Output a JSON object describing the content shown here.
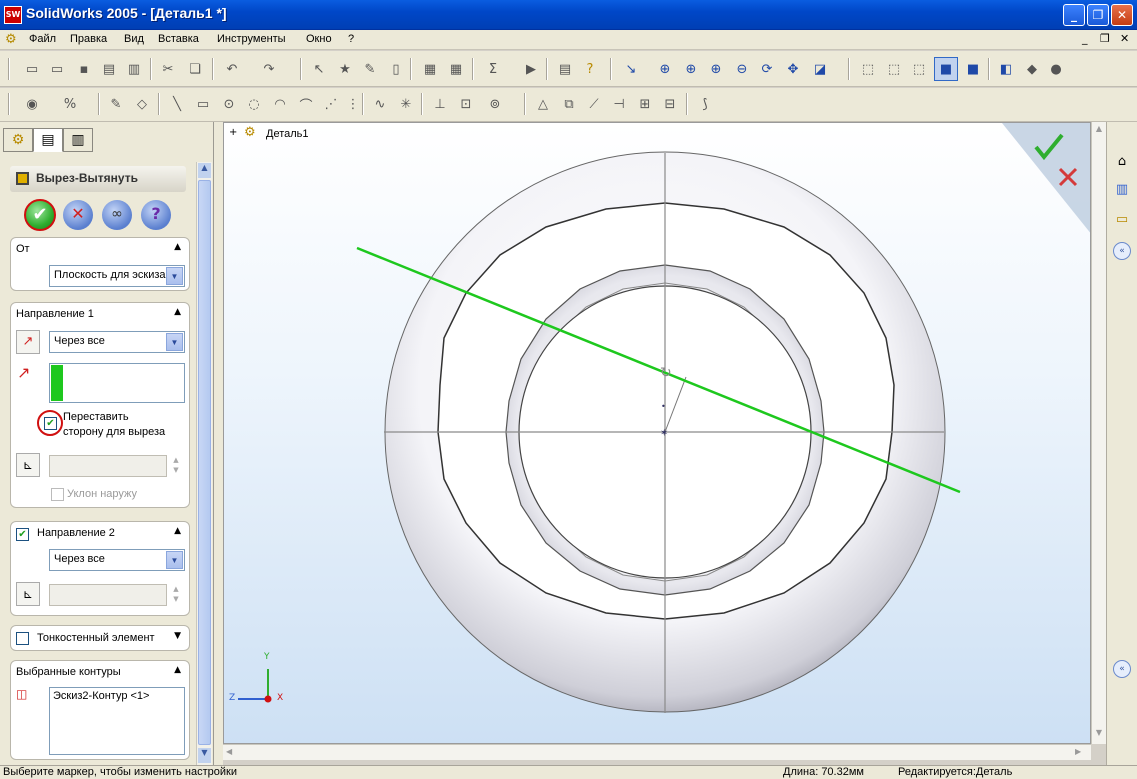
{
  "window": {
    "title": "SolidWorks 2005 - [Деталь1 *]",
    "app_icon_text": "SW"
  },
  "menu": [
    "Файл",
    "Правка",
    "Вид",
    "Вставка",
    "Инструменты",
    "Окно",
    "?"
  ],
  "feature_manager": {
    "feature_title": "Вырез-Вытянуть",
    "from_section": {
      "label": "От",
      "selected": "Плоскость для эскиза"
    },
    "direction1": {
      "label": "Направление 1",
      "end_condition": "Через все",
      "flip_side_label_line1": "Переставить",
      "flip_side_label_line2": "сторону для выреза",
      "flip_side_checked": true,
      "draft_outward_label": "Уклон наружу"
    },
    "direction2": {
      "label": "Направление 2",
      "enabled": true,
      "end_condition": "Через все"
    },
    "thin_feature": {
      "label": "Тонкостенный элемент"
    },
    "selected_contours": {
      "label": "Выбранные контуры",
      "items": [
        "Эскиз2-Контур <1>"
      ]
    }
  },
  "tree": {
    "root": "Деталь1"
  },
  "triad": {
    "x": "X",
    "y": "Y",
    "z": "Z"
  },
  "status": {
    "message": "Выберите маркер, чтобы изменить настройки",
    "length": "Длина: 70.32мм",
    "mode": "Редактируется:Деталь"
  },
  "colors": {
    "accept": "#2fae2f",
    "cancel": "#d43a3a",
    "sketch_line": "#1ec81e",
    "title_bar": "#0a5de0"
  }
}
